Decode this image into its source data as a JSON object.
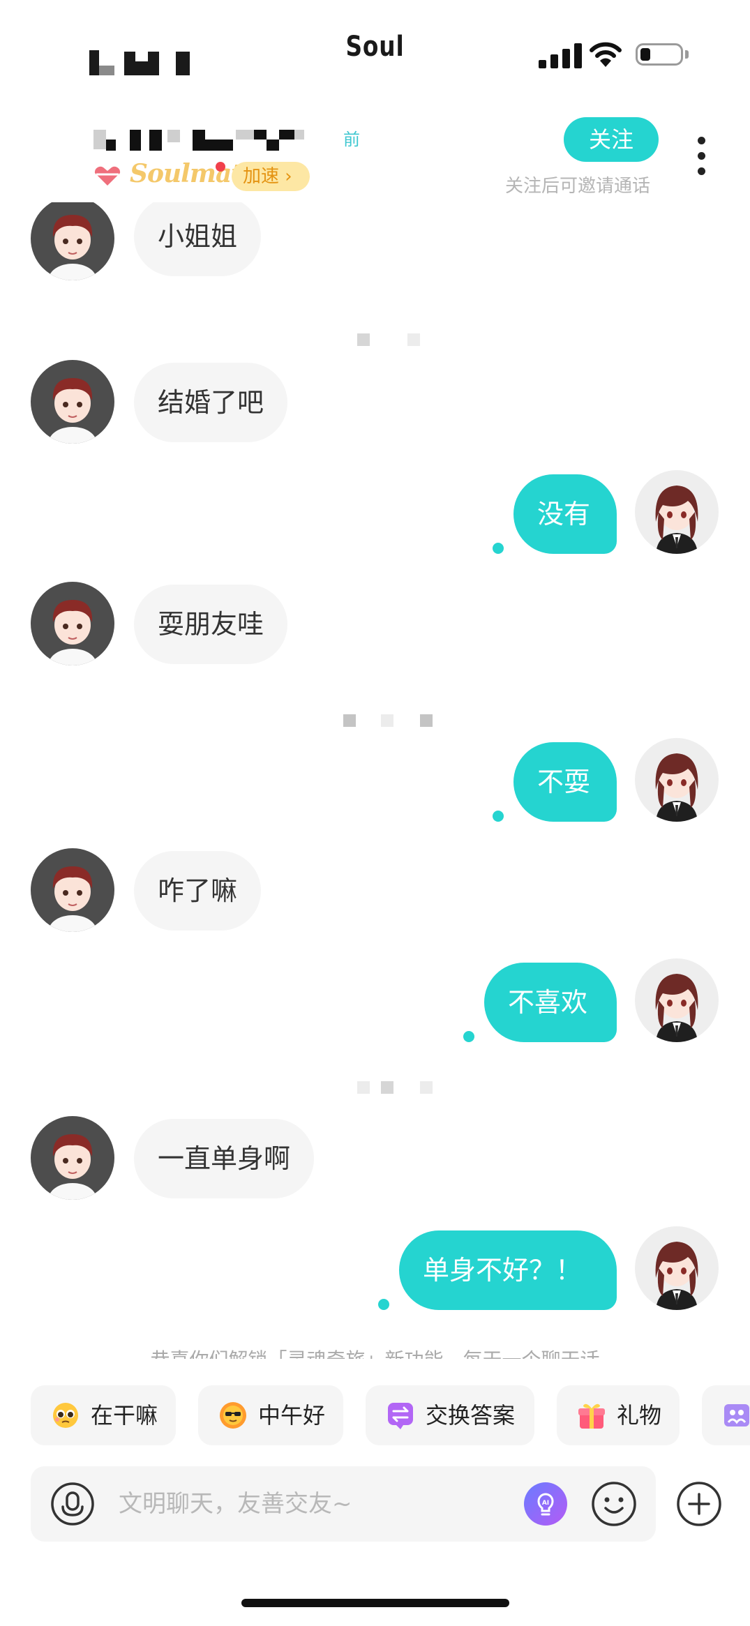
{
  "status_bar": {
    "app_name": "Soul"
  },
  "header": {
    "last_seen": "前",
    "soulmate_label": "Soulmate",
    "speed_label": "加速 ›",
    "follow_label": "关注",
    "follow_hint": "关注后可邀请通话"
  },
  "messages": [
    {
      "side": "in",
      "text": "小姐姐"
    },
    {
      "side": "in",
      "text": "结婚了吧"
    },
    {
      "side": "out",
      "text": "没有"
    },
    {
      "side": "in",
      "text": "耍朋友哇"
    },
    {
      "side": "out",
      "text": "不耍"
    },
    {
      "side": "in",
      "text": "咋了嘛"
    },
    {
      "side": "out",
      "text": "不喜欢"
    },
    {
      "side": "in",
      "text": "一直单身啊"
    },
    {
      "side": "out",
      "text": "单身不好？！"
    }
  ],
  "system_notice": "恭喜你们解锁「灵魂奇旅」新功能，每天一个聊天话",
  "quick_replies": [
    {
      "label": "在干嘛",
      "icon": "pleading-face-icon"
    },
    {
      "label": "中午好",
      "icon": "sun-sunglasses-icon"
    },
    {
      "label": "交换答案",
      "icon": "exchange-icon"
    },
    {
      "label": "礼物",
      "icon": "gift-icon"
    },
    {
      "label": "",
      "icon": "more-feature-icon"
    }
  ],
  "input": {
    "placeholder": "文明聊天，友善交友~",
    "mic_icon": "microphone-icon",
    "ai_icon": "ai-lightbulb-icon",
    "emoji_icon": "smiley-icon",
    "plus_icon": "plus-circle-icon"
  },
  "colors": {
    "accent": "#25d4d0",
    "incoming_bubble": "#f5f5f5",
    "follow_button": "#25d4d0",
    "speed_badge_bg": "#fde7a4",
    "speed_badge_text": "#e49312"
  }
}
